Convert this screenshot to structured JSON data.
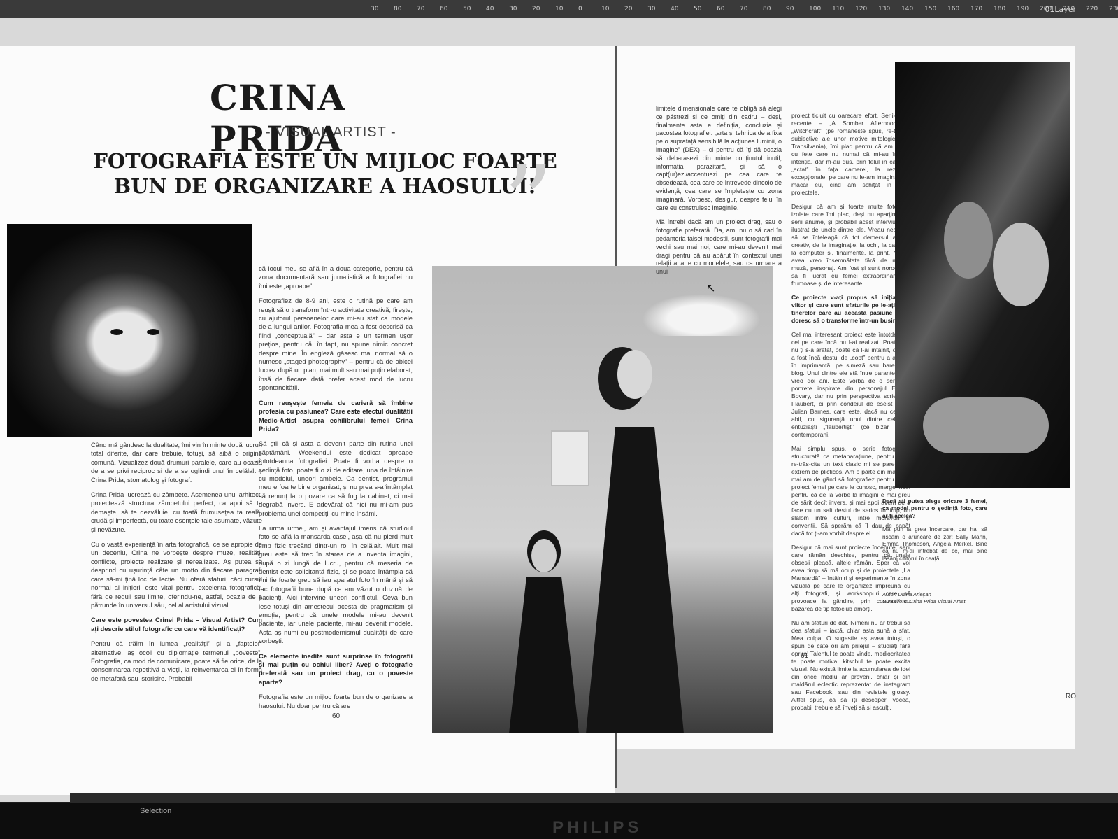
{
  "ruler": {
    "ticks": [
      "30",
      "80",
      "70",
      "60",
      "50",
      "40",
      "30",
      "20",
      "10",
      "0",
      "10",
      "20",
      "30",
      "40",
      "50",
      "60",
      "70",
      "80",
      "90",
      "100",
      "110",
      "120",
      "130",
      "140",
      "150",
      "160",
      "170",
      "180",
      "190",
      "200",
      "210",
      "220",
      "230"
    ],
    "layer": "01Layer"
  },
  "article": {
    "name": "CRINA PRIDA",
    "role": "- VISUAL ARTIST -",
    "quote_title": "FOTOGRAFIA ESTE UN MIJLOC FOARTE BUN DE ORGANIZARE A HAOSULUI!",
    "quote_mark": "”",
    "col1": [
      "Când mă gândesc la dualitate, îmi vin în minte două lucruri total diferite, dar care trebuie, totuși, să aibă o origine comună. Vizualizez două drumuri paralele, care au ocazia de a se privi reciproc și de a se oglindi unul în celălalt – Crina Prida, stomatolog și fotograf.",
      "Crina Prida lucrează cu zâmbete. Asemenea unui arhitect, proiectează structura zâmbetului perfect, ca apoi să te demaște, să te dezvăluie, cu toată frumusețea ta reală, crudă și imperfectă, cu toate esențele tale asumate, văzute și nevăzute.",
      "Cu o vastă experiență în arta fotografică, ce se apropie de un deceniu, Crina ne vorbește despre muze, realități, conflicte, proiecte realizate și nerealizate. Aș putea să desprind cu ușurință câte un motto din fiecare paragraf, care să-mi țină loc de lecție. Nu oferă sfaturi, căci cursul normal al inițierii este vital pentru excelența fotografică, fără de reguli sau limite, oferindu-ne, astfel, ocazia de a pătrunde în universul său, cel al artistului vizual."
    ],
    "q1": "Care este povestea Crinei Prida – Visual Artist? Cum ați descrie stilul fotografic cu care vă identificați?",
    "col1_end": "Pentru că trăim în lumea „realității” și a „faptelor” alternative, aș ocoli cu diplomație termenul „poveste”. Fotografia, ca mod de comunicare, poate să fie orice, de la consemnarea repetitivă a vieții, la reinventarea ei în formă de metaforă sau istorisire. Probabil",
    "col2": [
      "că locul meu se află în a doua categorie, pentru că zona documentară sau jurnalistică a fotografiei nu îmi este „aproape”.",
      "Fotografiez de 8-9 ani, este o rutină pe care am reușit să o transform într-o activitate creativă, firește, cu ajutorul persoanelor care mi-au stat ca modele de-a lungul anilor. Fotografia mea a fost descrisă ca fiind „conceptuală” – dar asta e un termen ușor prețios, pentru că, în fapt, nu spune nimic concret despre mine. În engleză găsesc mai normal să o numesc „staged photography” – pentru că de obicei lucrez după un plan, mai mult sau mai puțin elaborat, însă de fiecare dată prefer acest mod de lucru spontaneității."
    ],
    "q2": "Cum reușește femeia de carieră să îmbine profesia cu pasiunea? Care este efectul dualității Medic-Artist asupra echilibrului femeii Crina Prida?",
    "col2_b": [
      "Să știi că și asta a devenit parte din rutina unei săptămâni. Weekendul este dedicat aproape întotdeauna fotografiei. Poate fi vorba despre o ședință foto, poate fi o zi de editare, una de întâlnire cu modelul, uneori ambele. Ca dentist, programul meu e foarte bine organizat, și nu prea s-a întâmplat să renunț la o pozare ca să fug la cabinet, ci mai degrabă invers. E adevărat că nici nu mi-am pus problema unei competiții cu mine însămi.",
      "La urma urmei, am și avantajul imens că studioul foto se află la mansarda casei, așa că nu pierd mult timp fizic trecând dintr-un rol în celălalt. Mult mai greu este să trec în starea de a inventa imagini, după o zi lungă de lucru, pentru că meseria de dentist este solicitantă fizic, și se poate întâmpla să îmi fie foarte greu să iau aparatul foto în mână și să fac fotografii bune după ce am văzut o duzină de pacienți. Aici intervine uneori conflictul. Ceva bun iese totuși din amestecul acesta de pragmatism și emoție, pentru că unele modele mi-au devenit pacientе, iar unele paciente, mi-au devenit modele. Asta aș numi eu postmodernismul dualității de care vorbeşti."
    ],
    "q3": "Ce elemente inedite sunt surprinse în fotografii și mai puțin cu ochiul liber? Aveți o fotografie preferată sau un proiect drag, cu o poveste aparte?",
    "col2_end": "Fotografia este un mijloc foarte bun de organizare a haosului. Nu doar pentru că are",
    "col3": [
      "limitele dimensionale care te obligă să alegi ce păstrezi și ce omiți din cadru – deși, finalmente asta e definiția, concluzia și pacostea fotografiei: „arta și tehnica de a fixa pe o suprafață sensibilă la acțiunea luminii, o imagine” (DEX) – ci pentru că îți dă ocazia să debarasezi din minte conținutul inutil, informația parazitară, și să o capt(ur)ezi/accentuezi pe cea care te obsedează, cea care se întrevede dincolo de evidență, cea care se împletește cu zona imaginară. Vorbesc, desigur, despre felul în care eu construiesc imaginile.",
      "Mă întrebi dacă am un proiect drag, sau o fotografie preferată. Da, am, nu o să cad în pedanteria falsei modestii, sunt fotografii mai vechi sau mai noi, care mi-au devenit mai dragi pentru că au apărut în contextul unei relații aparte cu modelele, sau ca urmare a unui"
    ],
    "col4": [
      "proiect ticluit cu oarecare efort. Seriile mai recente – „A Somber Afternoon” și „Witchcraft” (pe românește spus, re-trasări subiective ale unor motive mitologice din Transilvania), îmi plac pentru că am lucrat cu fete care nu numai că mi-au înțeles intenția, dar m-au dus, prin felul în care au „actat” în fața camerei, la rezultate excepționale, pe care nu le-am imaginat nici măcar eu, cînd am schițat în scris proiectele.",
      "Desigur că am și foarte multe fotografii izolate care îmi plac, deși nu aparțin unor serii anume, și probabil acest interviu va fi ilustrat de unele dintre ele. Vreau neapărat să se înțeleagă că tot demersul acesta creativ, de la imaginație, la ochi, la cameră, la computer și, finalmente, la print, NU ar avea vreo însemnătate fără de model, muză, personaj. Am fost și sunt norocoasă să fi lucrat cu femei extraordinare de frumoase și de interesante."
    ],
    "q4": "Ce proiecte v-ați propus să inițiați pe viitor și care sunt sfaturile pe le-ați oferi tinerelor care au această pasiune și își doresc să o transforme într-un business?",
    "col4_b": [
      "Cel mai interesant proiect este întotdeauna cel pe care încă nu l-ai realizat. Poate nici nu ți s-a arătat, poate că l-ai întâlnit, dar nu a fost încă destul de „copt” pentru a ajunge în imprimantă, pe simeză sau barem pe blog. Unul dintre ele stă între paranteze de vreo doi ani. Este vorba de o serie de portrete inspirate din personajul Emmei Bovary, dar nu prin perspectiva scrierii lui Flaubert, ci prin condeiul de eseist al lui Julian Barnes, care este, dacă nu cel mai abil, cu siguranță unul dintre cel mai entuziaști „flaubertiști” (ce bizar sună) contemporani.",
      "Mai simplu spus, o serie fotografică structurată ca metanarațiune, pentru că a re-trăs-cita un text clasic mi se pare ceva extrem de plicticos. Am o parte din material, mai am de gând să fotografiez pentru acest proiect femei pe care le cunosc, merge încet pentru că de la vorbe la imagini e mai greu de sărit decît invers, și mai apoi avem de a face cu un salt destul de serios în timp, un slalom între culturi, între moravuri și convenții. Să sperăm că îl dau de capăt dacă tot ți-am vorbit despre el.",
      "Desigur că mai sunt proiecte începute, serii care rămân deschise, pentru că unele obsesii pleacă, altele rămân. Sper că voi avea timp să mă ocup și de proiectele „La Mansardă” – întâlniri și experimente în zona vizuală pe care le organizez împreună cu alți fotografi, și workshopuri care să provoace la gândire, prin contrast cu bazarea de tip fotoclub amorți.",
      "Nu am sfaturi de dat. Nimeni nu ar trebui să dea sfaturi – iactă, chiar asta sună a sfat. Mea culpa. O sugestie aș avea totuși, o spun de câte ori am prilejul – studiați fără oprire! Talentul te poate vinde, mediocritatea te poate motiva, kitschul te poate excita vizual. Nu există limite la acumularea de idei din orice mediu ar proveni, chiar și din maldărul eclectic reprezentat de instagram sau Facebook, sau din revistele glossy. Altfel spus, ca să îți descoperi vocea, probabil trebuie să înveți să și asculți."
    ],
    "q5": "Dacă ați putea alege oricare 3 femei, ca model pentru o ședință foto, care ar fi acelea?",
    "col5": "Mă pun la grea încercare, dar hai să riscăm o aruncare de zar: Sally Mann, Emma Thompson, Angela Merkel. Bine că nu m-ai întrebat de ce, mai bine lăsăm cititorul în ceață.",
    "credits": [
      "Autor: Diana Arieșan",
      "Sursa foto: Crina Prida Visual Artist"
    ],
    "page_left": "60",
    "page_right": "61"
  },
  "status": {
    "mode": "Selection",
    "brand": "PHILIPS",
    "tray": "RO"
  }
}
